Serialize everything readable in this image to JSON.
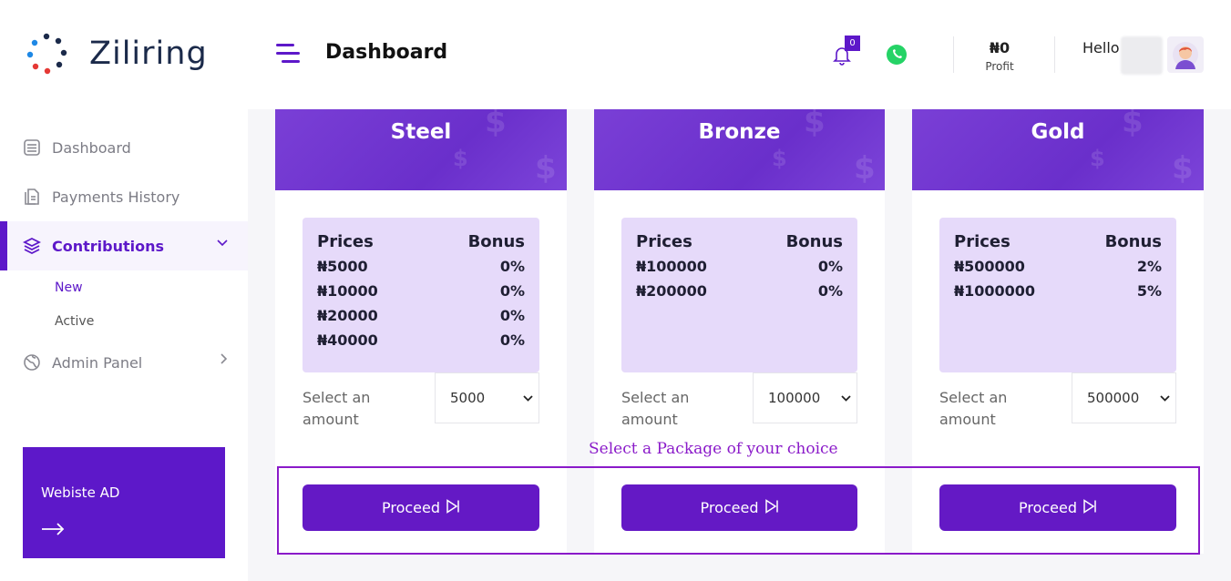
{
  "brand": {
    "name": "Ziliring"
  },
  "sidebar": {
    "items": [
      {
        "label": "Dashboard",
        "icon": "dashboard-icon"
      },
      {
        "label": "Payments History",
        "icon": "payments-icon"
      },
      {
        "label": "Contributions",
        "icon": "layers-icon"
      },
      {
        "label": "Admin Panel",
        "icon": "globe-icon"
      }
    ],
    "sub_items": [
      {
        "label": "New"
      },
      {
        "label": "Active"
      }
    ],
    "ad": {
      "text": "Webiste AD",
      "icon": "arrow-right-icon"
    }
  },
  "header": {
    "title": "Dashboard",
    "notification_count": "0",
    "profit_value": "₦0",
    "profit_label": "Profit",
    "greeting": "Hello"
  },
  "packages": [
    {
      "name": "Steel",
      "prices_header": "Prices",
      "bonus_header": "Bonus",
      "rows": [
        {
          "price": "₦5000",
          "bonus": "0%"
        },
        {
          "price": "₦10000",
          "bonus": "0%"
        },
        {
          "price": "₦20000",
          "bonus": "0%"
        },
        {
          "price": "₦40000",
          "bonus": "0%"
        }
      ],
      "select_label": "Select an amount",
      "selected_amount": "5000",
      "button": "Proceed"
    },
    {
      "name": "Bronze",
      "prices_header": "Prices",
      "bonus_header": "Bonus",
      "rows": [
        {
          "price": "₦100000",
          "bonus": "0%"
        },
        {
          "price": "₦200000",
          "bonus": "0%"
        }
      ],
      "select_label": "Select an amount",
      "selected_amount": "100000",
      "button": "Proceed"
    },
    {
      "name": "Gold",
      "prices_header": "Prices",
      "bonus_header": "Bonus",
      "rows": [
        {
          "price": "₦500000",
          "bonus": "2%"
        },
        {
          "price": "₦1000000",
          "bonus": "5%"
        }
      ],
      "select_label": "Select an amount",
      "selected_amount": "500000",
      "button": "Proceed"
    }
  ],
  "hint": "Select a Package of your choice",
  "colors": {
    "accent": "#5d18c9",
    "panel": "#e6dafa",
    "hint": "#8a1ac9"
  }
}
